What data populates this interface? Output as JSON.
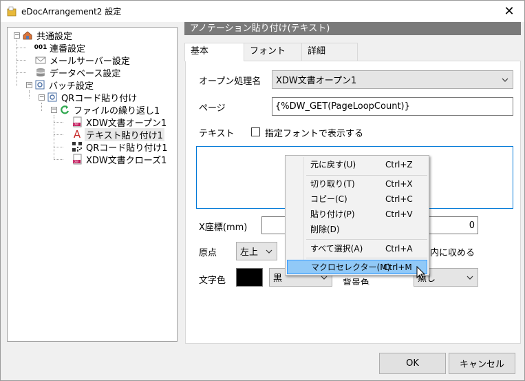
{
  "window": {
    "title": "eDocArrangement2 設定",
    "close_glyph": "✕"
  },
  "tree": {
    "items": [
      {
        "label": "共通設定",
        "icon": "house-icon"
      },
      {
        "label": "連番設定",
        "icon": "counter-icon",
        "icon_text": "001"
      },
      {
        "label": "メールサーバー設定",
        "icon": "mail-icon"
      },
      {
        "label": "データベース設定",
        "icon": "database-icon"
      },
      {
        "label": "バッチ設定",
        "icon": "batch-icon"
      },
      {
        "label": "QRコード貼り付け",
        "icon": "qr-batch-icon"
      },
      {
        "label": "ファイルの繰り返し1",
        "icon": "loop-icon"
      },
      {
        "label": "XDW文書オープン1",
        "icon": "xdw-icon"
      },
      {
        "label": "テキスト貼り付け1",
        "icon": "text-a-icon",
        "icon_text": "A"
      },
      {
        "label": "QRコード貼り付け1",
        "icon": "qr-code-icon"
      },
      {
        "label": "XDW文書クローズ1",
        "icon": "xdw-icon"
      }
    ]
  },
  "panel": {
    "header": "アノテーション貼り付け(テキスト)",
    "tabs": [
      {
        "label": "基本"
      },
      {
        "label": "フォント"
      },
      {
        "label": "詳細"
      }
    ],
    "open_process": {
      "label": "オープン処理名",
      "value": "XDW文書オープン1"
    },
    "page": {
      "label": "ページ",
      "value": "{%DW_GET(PageLoopCount)}"
    },
    "text": {
      "label": "テキスト",
      "checkbox_label": "指定フォントで表示する"
    },
    "x_coord": {
      "label": "X座標(mm)",
      "right_value": "0"
    },
    "origin": {
      "label": "原点",
      "value": "左上",
      "trailing_text": "内に収める"
    },
    "text_color": {
      "label": "文字色",
      "value": "黒",
      "color": "#000000"
    },
    "bg_color": {
      "label": "背景色",
      "value": "無し"
    }
  },
  "buttons": {
    "ok": "OK",
    "cancel": "キャンセル"
  },
  "context_menu": {
    "items": [
      {
        "label": "元に戻す(U)",
        "shortcut": "Ctrl+Z"
      },
      {
        "label": "切り取り(T)",
        "shortcut": "Ctrl+X"
      },
      {
        "label": "コピー(C)",
        "shortcut": "Ctrl+C"
      },
      {
        "label": "貼り付け(P)",
        "shortcut": "Ctrl+V"
      },
      {
        "label": "削除(D)",
        "shortcut": ""
      },
      {
        "label": "すべて選択(A)",
        "shortcut": "Ctrl+A"
      },
      {
        "label": "マクロセレクター(M)",
        "shortcut": "Ctrl+M"
      }
    ]
  }
}
